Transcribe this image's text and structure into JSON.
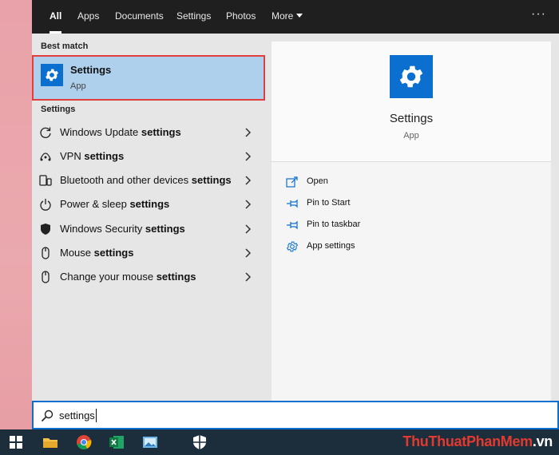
{
  "tabs": [
    {
      "label": "All",
      "active": true
    },
    {
      "label": "Apps"
    },
    {
      "label": "Documents"
    },
    {
      "label": "Settings"
    },
    {
      "label": "Photos"
    },
    {
      "label": "More"
    }
  ],
  "more_options_glyph": "···",
  "best_match": {
    "section": "Best match",
    "title": "Settings",
    "subtitle": "App",
    "icon": "gear-icon"
  },
  "settings_section": "Settings",
  "results": [
    {
      "text": "Windows Update ",
      "bold": "settings",
      "icon": "refresh-icon"
    },
    {
      "text": "VPN ",
      "bold": "settings",
      "icon": "vpn-icon"
    },
    {
      "text": "Bluetooth and other devices ",
      "bold": "settings",
      "icon": "devices-icon"
    },
    {
      "text": "Power & sleep ",
      "bold": "settings",
      "icon": "power-icon"
    },
    {
      "text": "Windows Security ",
      "bold": "settings",
      "icon": "shield-icon"
    },
    {
      "text": "Mouse ",
      "bold": "settings",
      "icon": "mouse-icon"
    },
    {
      "text": "Change your mouse ",
      "bold": "settings",
      "icon": "mouse-icon"
    }
  ],
  "detail": {
    "title": "Settings",
    "subtitle": "App",
    "actions": [
      {
        "label": "Open",
        "icon": "open-icon"
      },
      {
        "label": "Pin to Start",
        "icon": "pin-icon"
      },
      {
        "label": "Pin to taskbar",
        "icon": "pin-icon"
      },
      {
        "label": "App settings",
        "icon": "gear-icon"
      }
    ]
  },
  "search": {
    "value": "settings"
  },
  "taskbar": {
    "items": [
      "windows-start-icon",
      "file-explorer-icon",
      "chrome-icon",
      "excel-icon",
      "photos-icon",
      "security-icon"
    ]
  },
  "watermark": {
    "part1": "ThuThuat",
    "part2": "PhanMem",
    "part3": ".vn"
  },
  "colors": {
    "accent": "#0a6fcf",
    "highlight": "#aed0ec",
    "selection_border": "#e33d3d",
    "topbar": "#1f1f1f",
    "taskbar": "#1c2d3c"
  }
}
